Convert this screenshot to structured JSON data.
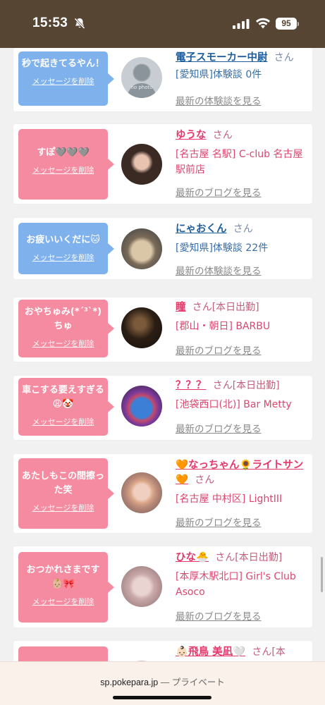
{
  "status": {
    "time": "15:53",
    "battery": "95"
  },
  "browser": {
    "domain": "sp.pokepara.jp",
    "mode": "— プライベート"
  },
  "common": {
    "delete_label": "メッセージを削除"
  },
  "items": [
    {
      "message": "秒で起きてるやん！",
      "bubble_color": "blue",
      "name": "電子スモーカー中尉",
      "name_color": "blue",
      "san": "さん",
      "extra": "",
      "detail": "[愛知県]体験談 0件",
      "latest": "最新の体験談を見る",
      "avatar": "no-photo-avatar"
    },
    {
      "message": "すぽ🩶🩶🩶",
      "bubble_color": "pink",
      "name": "ゆうな",
      "name_color": "pink",
      "san": "さん",
      "extra": "",
      "detail": "[名古屋 名駅] C-club 名古屋駅前店",
      "latest": "最新のブログを見る",
      "avatar": "girl-avatar"
    },
    {
      "message": "お疲いいくだに🐱",
      "bubble_color": "blue",
      "name": "にゃおくん",
      "name_color": "blue",
      "san": "さん",
      "extra": "",
      "detail": "[愛知県]体験談 22件",
      "latest": "最新の体験談を見る",
      "avatar": "cat-avatar"
    },
    {
      "message": "おやちゅみ(*´³`*) ちゅ",
      "bubble_color": "pink",
      "name": "瞳",
      "name_color": "pink",
      "san": "さん",
      "extra": "[本日出勤]",
      "detail": "[郡山・朝日] BARBU",
      "latest": "最新のブログを見る",
      "avatar": "dark-room-avatar"
    },
    {
      "message": "車こする要えすぎる😩🤡",
      "bubble_color": "pink",
      "name": "？？？",
      "name_color": "pink",
      "san": "さん",
      "extra": "[本日出勤]",
      "detail": "[池袋西口(北)] Bar Metty",
      "latest": "最新のブログを見る",
      "avatar": "slime-avatar"
    },
    {
      "message": "あたしもこの間擦った笑",
      "bubble_color": "pink",
      "name": "🧡なっちゃん🌻ライトサン🧡",
      "name_color": "pink",
      "san": "さん",
      "extra": "",
      "detail": "[名古屋 中村区] LightIII",
      "latest": "最新のブログを見る",
      "avatar": "blonde-girl-avatar"
    },
    {
      "message": "おつかれさまです👶🏼🎀",
      "bubble_color": "pink",
      "name": "ひな🐣",
      "name_color": "pink",
      "san": "さん",
      "extra": "[本日出勤]",
      "detail": "[本厚木駅北口] Girl's Club Asoco",
      "latest": "最新のブログを見る",
      "avatar": "flower-girl-avatar"
    },
    {
      "message": "",
      "bubble_color": "pink",
      "name": "👶🏻飛鳥 美凪🤍",
      "name_color": "pink",
      "san": "さん",
      "extra": "[本",
      "detail": "",
      "latest": "",
      "avatar": "partial-avatar"
    }
  ]
}
